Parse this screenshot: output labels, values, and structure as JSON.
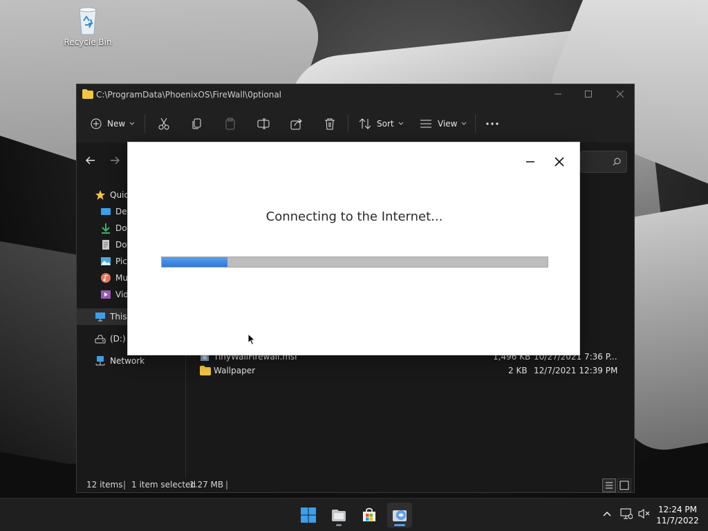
{
  "desktop": {
    "icons": [
      {
        "label": "Recycle Bin",
        "icon": "recycle-bin-icon"
      }
    ]
  },
  "explorer": {
    "path": "C:\\ProgramData\\PhoenixOS\\FireWall\\0ptional",
    "toolbar": {
      "new_label": "New",
      "sort_label": "Sort",
      "view_label": "View",
      "icons": [
        "cut-icon",
        "copy-icon",
        "paste-icon",
        "rename-icon",
        "share-icon",
        "delete-icon",
        "more-icon"
      ]
    },
    "sidebar": {
      "quick_access": "Quic",
      "items": [
        {
          "label": "Des",
          "icon": "desktop-folder-icon",
          "color": "#3aa0e8"
        },
        {
          "label": "Dov",
          "icon": "download-icon",
          "color": "#3cb371"
        },
        {
          "label": "Doc",
          "icon": "documents-icon",
          "color": "#c8c8c8"
        },
        {
          "label": "Pict",
          "icon": "pictures-icon",
          "color": "#4aa8e6"
        },
        {
          "label": "Mu",
          "icon": "music-icon",
          "color": "#e07a5f"
        },
        {
          "label": "Vid",
          "icon": "videos-icon",
          "color": "#9b59b6"
        }
      ],
      "this_pc": "This",
      "drive": "(D:) C",
      "network": "Network"
    },
    "files": [
      {
        "name": "TinyWallFirewall.msi",
        "size": "1,496 KB",
        "date": "10/27/2021 7:36 P..."
      },
      {
        "name": "Wallpaper",
        "size": "2 KB",
        "date": "12/7/2021 12:39 PM"
      }
    ],
    "status": {
      "items": "12 items",
      "selected": "1 item selected",
      "size": "1.27 MB"
    }
  },
  "dialog": {
    "message": "Connecting to the Internet...",
    "progress": 0.17,
    "progress_color": "#3a84dd"
  },
  "taskbar": {
    "apps": [
      "start-icon",
      "file-explorer-icon",
      "store-icon",
      "installer-app-icon"
    ],
    "time": "12:24 PM",
    "date": "11/7/2022"
  }
}
